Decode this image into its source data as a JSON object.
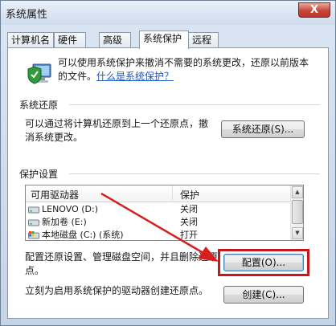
{
  "window": {
    "title": "系统属性",
    "close_label": "X"
  },
  "tabs": [
    "计算机名",
    "硬件",
    "高级",
    "系统保护",
    "远程"
  ],
  "active_tab": "系统保护",
  "intro": {
    "text": "可以使用系统保护来撤消不需要的系统更改，还原以前版本的文件。",
    "link": "什么是系统保护？"
  },
  "restore": {
    "group_title": "系统还原",
    "description": "可以通过将计算机还原到上一个还原点，撤消系统更改。",
    "button_label": "系统还原(S)..."
  },
  "protection": {
    "group_title": "保护设置",
    "columns": [
      "可用驱动器",
      "保护"
    ],
    "drives": [
      {
        "name": "LENOVO (D:)",
        "status": "关闭",
        "icon": "drive-icon"
      },
      {
        "name": "新加卷 (E:)",
        "status": "关闭",
        "icon": "drive-icon"
      },
      {
        "name": "本地磁盘 (C:) (系统)",
        "status": "打开",
        "icon": "system-drive-icon"
      }
    ]
  },
  "configure": {
    "description": "配置还原设置、管理磁盘空间，并且删除还原点。",
    "button_label": "配置(O)..."
  },
  "create": {
    "description": "立刻为启用系统保护的驱动器创建还原点。",
    "button_label": "创建(C)..."
  },
  "colors": {
    "highlight": "#c8161d",
    "arrow": "#d62020",
    "link": "#1c58c3"
  }
}
